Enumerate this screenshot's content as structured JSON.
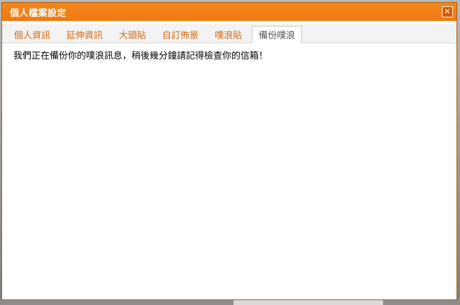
{
  "dialog": {
    "title": "個人檔案設定",
    "close_glyph": "✕"
  },
  "tabs": [
    {
      "label": "個人資訊",
      "active": false
    },
    {
      "label": "延伸資訊",
      "active": false
    },
    {
      "label": "大頭貼",
      "active": false
    },
    {
      "label": "自訂佈景",
      "active": false
    },
    {
      "label": "噗浪貼",
      "active": false
    },
    {
      "label": "備份噗浪",
      "active": true
    }
  ],
  "content": {
    "message": "我們正在備份你的噗浪訊息，稍後幾分鐘請記得檢查你的信箱！"
  },
  "colors": {
    "accent": "#f08317",
    "tab_text": "#d26b16",
    "active_tab_text": "#555555"
  }
}
